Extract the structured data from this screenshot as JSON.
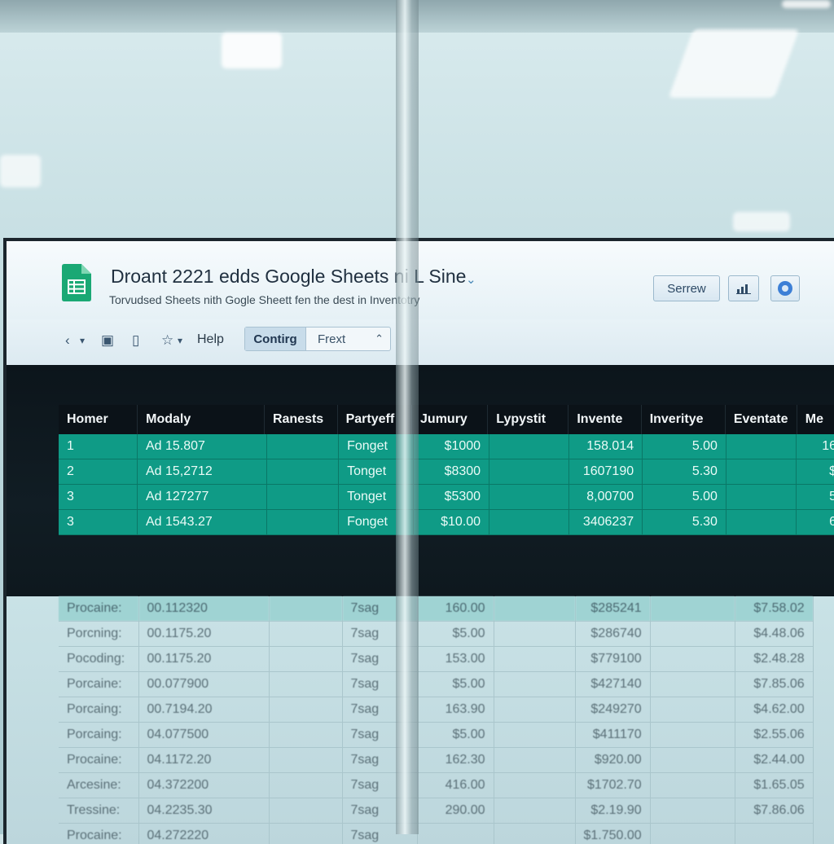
{
  "app": {
    "title": "Droant 2221 edds Google Sheets ni L Sine",
    "subtitle": "Torvudsed Sheets nith Gogle Sheett fen the dest in Inventotry"
  },
  "header_buttons": {
    "serrew": "Serrew"
  },
  "toolbar": {
    "help": "Help",
    "segment_active": "Contirg",
    "segment_other": "Frext"
  },
  "columns": [
    "Homer",
    "Modaly",
    "Ranests",
    "Partyeff",
    "Jumury",
    "Lypystit",
    "Invente",
    "Inverityе",
    "Eventate",
    "Me"
  ],
  "teal_rows": [
    [
      "1",
      "Ad 15.807",
      "",
      "Fonget",
      "$1000",
      "",
      "158.014",
      "5.00",
      "",
      "16"
    ],
    [
      "2",
      "Ad 15,2712",
      "",
      "Tonget",
      "$8300",
      "",
      "1607190",
      "5.30",
      "",
      "$"
    ],
    [
      "3",
      "Ad 127277",
      "",
      "Tonget",
      "$5300",
      "",
      "8,00700",
      "5.00",
      "",
      "5"
    ],
    [
      "3",
      "Ad 1543.27",
      "",
      "Fonget",
      "$10.00",
      "",
      "3406237",
      "5.30",
      "",
      "6"
    ]
  ],
  "light_rows": [
    [
      "Procaine:",
      "00.112320",
      "",
      "7sag",
      "160.00",
      "",
      "$285241",
      "",
      "$7.58.02"
    ],
    [
      "Porcning:",
      "00.1175.20",
      "",
      "7sag",
      "$5.00",
      "",
      "$286740",
      "",
      "$4.48.06"
    ],
    [
      "Pocoding:",
      "00.1175.20",
      "",
      "7sag",
      "153.00",
      "",
      "$779100",
      "",
      "$2.48.28"
    ],
    [
      "Porcaine:",
      "00.077900",
      "",
      "7sag",
      "$5.00",
      "",
      "$427140",
      "",
      "$7.85.06"
    ],
    [
      "Porcaing:",
      "00.7194.20",
      "",
      "7sag",
      "163.90",
      "",
      "$249270",
      "",
      "$4.62.00"
    ],
    [
      "Porcaing:",
      "04.077500",
      "",
      "7sag",
      "$5.00",
      "",
      "$411170",
      "",
      "$2.55.06"
    ],
    [
      "Procaine:",
      "04.1172.20",
      "",
      "7sag",
      "162.30",
      "",
      "$920.00",
      "",
      "$2.44.00"
    ],
    [
      "Arcesine:",
      "04.372200",
      "",
      "7sag",
      "416.00",
      "",
      "$1702.70",
      "",
      "$1.65.05"
    ],
    [
      "Tressine:",
      "04.2235.30",
      "",
      "7sag",
      "290.00",
      "",
      "$2.19.90",
      "",
      "$7.86.06"
    ],
    [
      "Procaine:",
      "04.272220",
      "",
      "7sag",
      "",
      "",
      "$1.750.00",
      "",
      ""
    ]
  ]
}
